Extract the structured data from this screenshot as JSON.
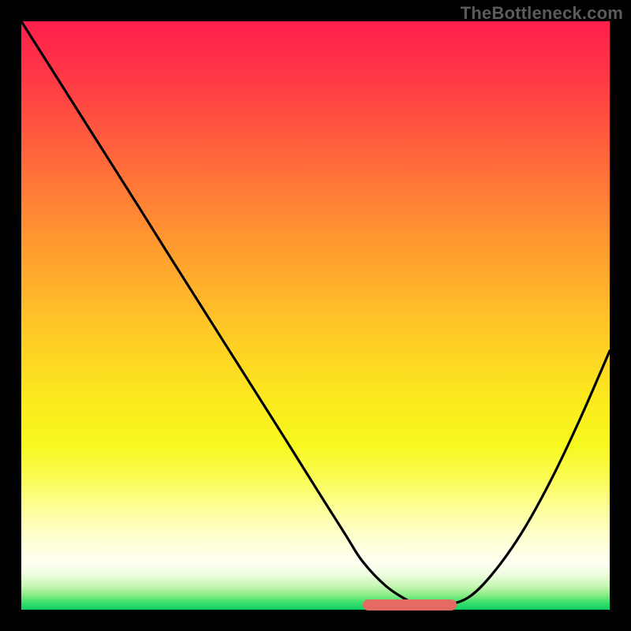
{
  "watermark": "TheBottleneck.com",
  "colors": {
    "curve": "#000000",
    "flat_marker": "#e46a62",
    "frame": "#000000"
  },
  "chart_data": {
    "type": "line",
    "title": "",
    "xlabel": "",
    "ylabel": "",
    "xlim": [
      0,
      100
    ],
    "ylim": [
      0,
      100
    ],
    "grid": false,
    "legend": false,
    "series": [
      {
        "name": "bottleneck-curve",
        "x": [
          0,
          5,
          10,
          15,
          20,
          25,
          30,
          35,
          40,
          45,
          50,
          55,
          58,
          62,
          66,
          68,
          72,
          76,
          80,
          85,
          90,
          95,
          100
        ],
        "y": [
          100,
          92.1,
          84.2,
          76.3,
          68.4,
          60.4,
          52.5,
          44.6,
          36.7,
          28.8,
          20.8,
          12.9,
          8.2,
          4.0,
          1.4,
          0.8,
          0.8,
          2.1,
          6.0,
          13.0,
          22.0,
          32.5,
          44.0
        ]
      }
    ],
    "flat_region": {
      "x_start": 58,
      "x_end": 74,
      "y": 0.8
    },
    "background_gradient": {
      "orientation": "vertical",
      "stops": [
        {
          "pos": 0.0,
          "color": "#ff1f4c"
        },
        {
          "pos": 0.5,
          "color": "#ffc727"
        },
        {
          "pos": 0.78,
          "color": "#fafc58"
        },
        {
          "pos": 0.92,
          "color": "#fffff2"
        },
        {
          "pos": 1.0,
          "color": "#0fd164"
        }
      ]
    }
  }
}
